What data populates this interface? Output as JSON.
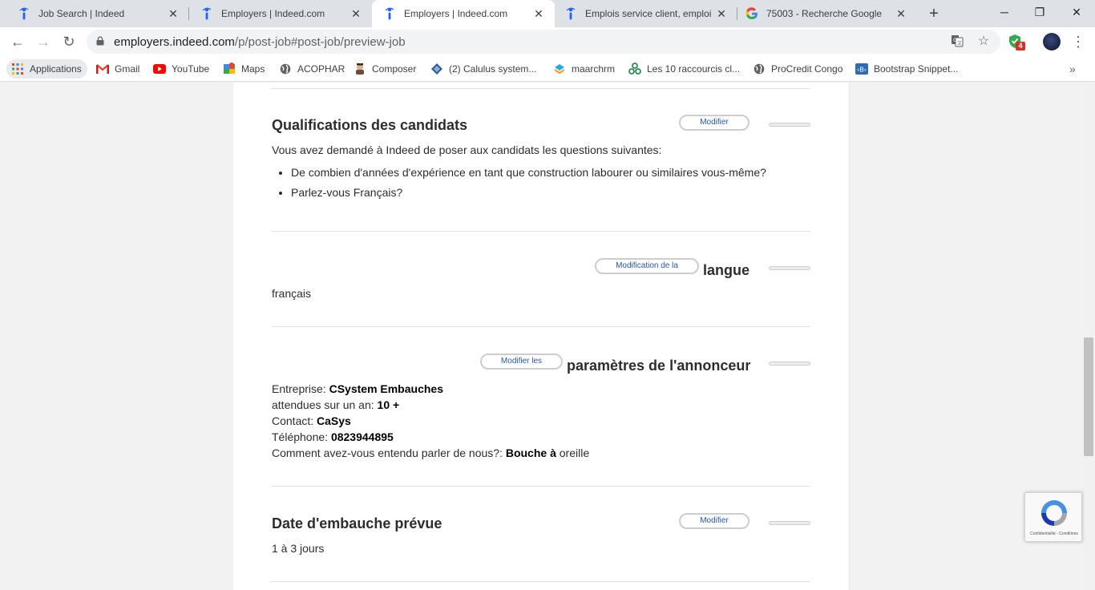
{
  "tabs": [
    {
      "title": "Job Search | Indeed",
      "icon": "indeed-icon",
      "active": false
    },
    {
      "title": "Employers | Indeed.com",
      "icon": "indeed-icon",
      "active": false
    },
    {
      "title": "Employers | Indeed.com",
      "icon": "indeed-icon",
      "active": true
    },
    {
      "title": "Emplois service client, emploi |",
      "icon": "indeed-icon",
      "active": false
    },
    {
      "title": "75003 - Recherche Google",
      "icon": "google-icon",
      "active": false
    }
  ],
  "toolbar": {
    "url_host": "employers.indeed.com",
    "url_path": "/p/post-job#post-job/preview-job",
    "extension_badge": "4"
  },
  "bookmarks": [
    {
      "label": "Applications",
      "icon": "apps-grid-icon"
    },
    {
      "label": "Gmail",
      "icon": "gmail-icon"
    },
    {
      "label": "YouTube",
      "icon": "youtube-icon"
    },
    {
      "label": "Maps",
      "icon": "maps-icon"
    },
    {
      "label": "ACOPHAR",
      "icon": "globe-icon"
    },
    {
      "label": "Composer",
      "icon": "composer-icon"
    },
    {
      "label": "(2) Calulus system...",
      "icon": "calulus-icon"
    },
    {
      "label": "maarchrm",
      "icon": "maarch-icon"
    },
    {
      "label": "Les 10 raccourcis cl...",
      "icon": "raccourcis-icon"
    },
    {
      "label": "ProCredit Congo",
      "icon": "globe-icon"
    },
    {
      "label": "Bootstrap Snippet...",
      "icon": "bootstrap-icon"
    }
  ],
  "sections": {
    "qualifications": {
      "title": "Qualifications des candidats",
      "button": "Modifier",
      "intro": "Vous avez demandé à Indeed de poser aux candidats les questions suivantes:",
      "questions": [
        "De combien d'années d'expérience en tant que construction labourer ou similaires vous-même?",
        "Parlez-vous Français?"
      ]
    },
    "language": {
      "button": "Modification de la",
      "title": "langue",
      "value": "français"
    },
    "advertiser": {
      "button": "Modifier les",
      "title": "paramètres de l'annonceur",
      "company_label": "Entreprise: ",
      "company_value": "CSystem Embauches",
      "expected_label": "attendues sur un an: ",
      "expected_value": "10 +",
      "contact_label": "Contact: ",
      "contact_value": "CaSys",
      "phone_label": "Téléphone: ",
      "phone_value": "0823944895",
      "source_label": "Comment avez-vous entendu parler de nous?: ",
      "source_value_bold": "Bouche à",
      "source_value_rest": " oreille"
    },
    "hire_date": {
      "title": "Date d'embauche prévue",
      "button": "Modifier",
      "value": "1 à 3 jours"
    }
  },
  "recaptcha": {
    "terms": "Confidentialité - Conditions"
  }
}
